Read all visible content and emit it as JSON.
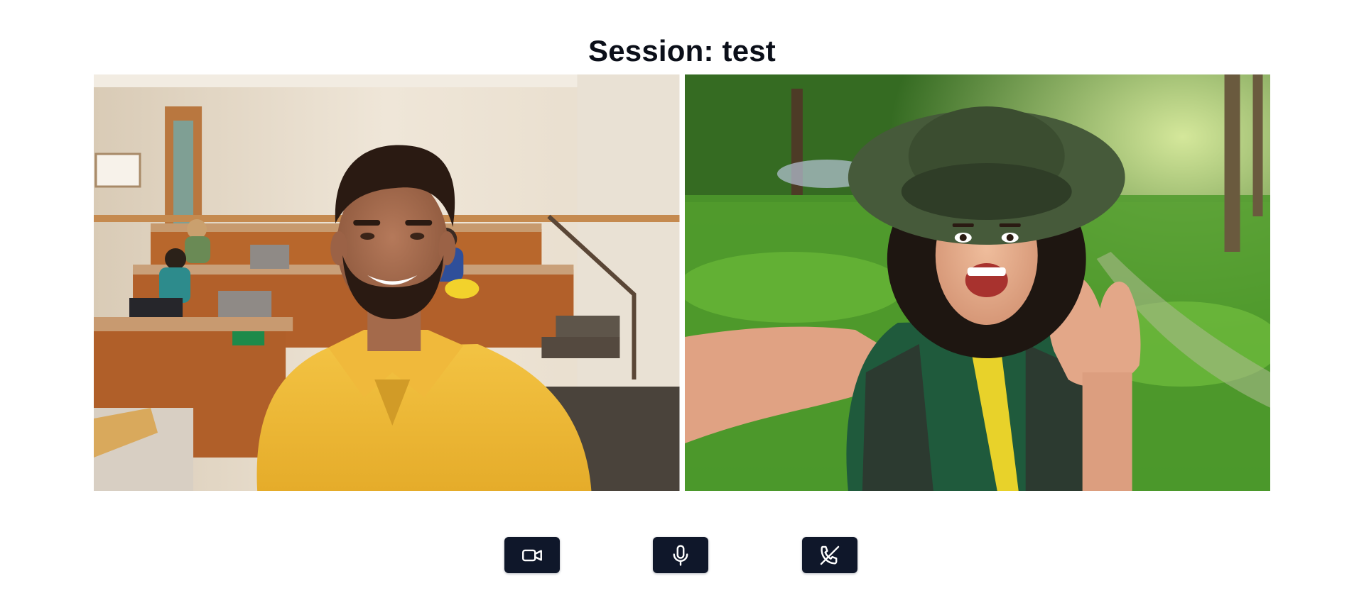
{
  "page": {
    "title": "Session: test"
  },
  "participants": [
    {
      "tile_name": "video-tile-participant-1",
      "scene": "classroom"
    },
    {
      "tile_name": "video-tile-participant-2",
      "scene": "park"
    }
  ],
  "controls": {
    "camera": {
      "icon": "video-camera-icon"
    },
    "microphone": {
      "icon": "microphone-icon"
    },
    "hangup": {
      "icon": "phone-off-icon"
    }
  },
  "colors": {
    "button_bg": "#0f172a",
    "title_text": "#0b0f19",
    "icon_stroke": "#ffffff"
  }
}
